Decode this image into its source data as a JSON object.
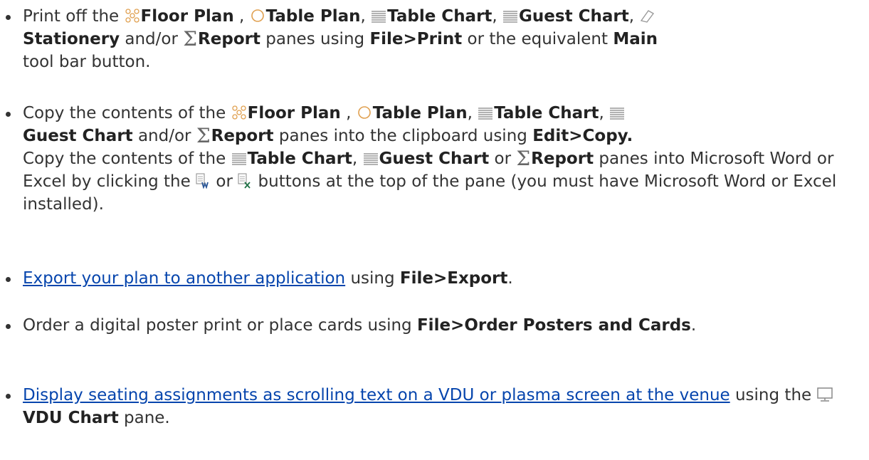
{
  "colors": {
    "text": "#333333",
    "link": "#0645ad",
    "icon_grey": "#999999",
    "icon_orange": "#e0a050"
  },
  "common": {
    "floor_plan": "Floor Plan",
    "table_plan": "Table Plan",
    "table_chart": "Table Chart",
    "guest_chart": "Guest Chart",
    "stationery": "Stationery",
    "report": "Report",
    "vdu_chart": "VDU Chart",
    "sigma": "Σ"
  },
  "items": [
    {
      "t1": "Print off the ",
      "t2": " , ",
      "t3": ", ",
      "t4": ", ",
      "t5": ", ",
      "t6": " and/or ",
      "t7": " panes using ",
      "menu": "File>Print",
      "t8": " or the equivalent ",
      "main": "Main",
      "t9": " tool bar button."
    },
    {
      "t1": "Copy the contents of the ",
      "t2": " , ",
      "t3": ", ",
      "t4": ", ",
      "t5": " and/or ",
      "t6": " panes into the clipboard using ",
      "menu": "Edit>Copy.",
      "t7": "Copy the contents of the ",
      "t8": ", ",
      "t9": " or ",
      "t10": " panes into Microsoft Word or Excel by clicking the ",
      "t11": " or ",
      "t12": " buttons at the top of the pane (you must have Microsoft Word or Excel installed)."
    },
    {
      "link": "Export your plan to another application",
      "t1": " using ",
      "menu": "File>Export",
      "t2": "."
    },
    {
      "t1": "Order a digital poster print or place cards using ",
      "menu": "File>Order Posters and Cards",
      "t2": "."
    },
    {
      "link": "Display seating assignments as scrolling text on a VDU or plasma screen at the venue",
      "t1": " using the ",
      "t2": " pane."
    }
  ],
  "icons": {
    "floor_plan": "floor-plan-icon",
    "table_plan": "table-plan-icon",
    "table_chart": "table-chart-icon",
    "guest_chart": "guest-chart-icon",
    "stationery": "stationery-icon",
    "report": "report-sigma-icon",
    "word": "word-export-icon",
    "excel": "excel-export-icon",
    "vdu": "vdu-monitor-icon"
  }
}
